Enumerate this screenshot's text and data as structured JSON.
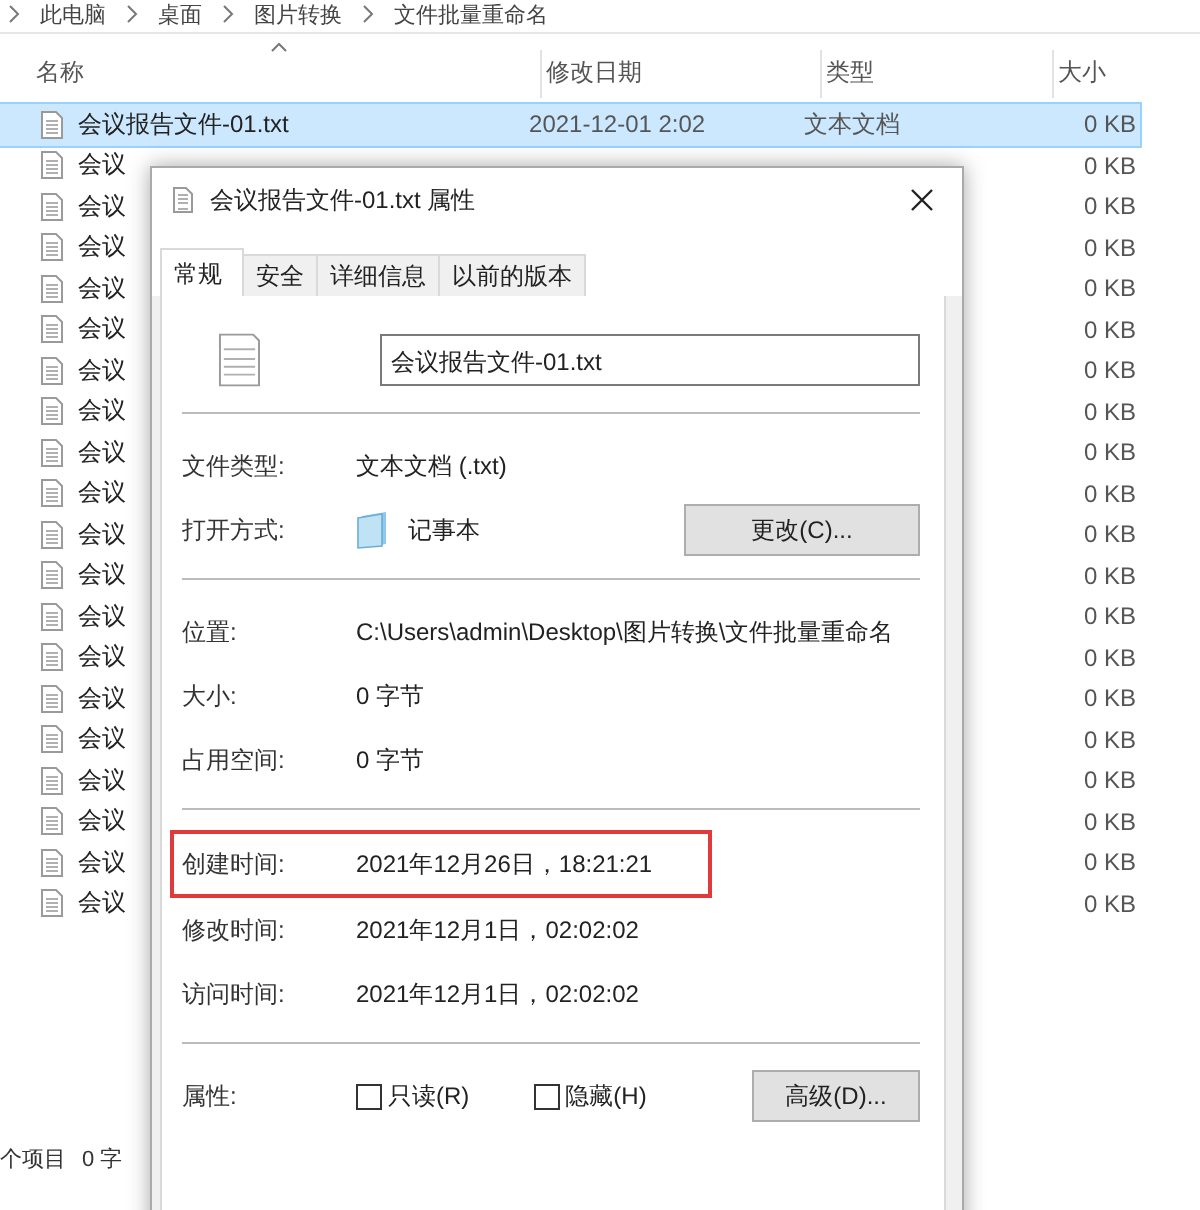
{
  "breadcrumb": [
    "此电脑",
    "桌面",
    "图片转换",
    "文件批量重命名"
  ],
  "file_list": {
    "columns": [
      "名称",
      "修改日期",
      "类型",
      "大小"
    ],
    "rows": [
      {
        "name": "会议报告文件-01.txt",
        "modified": "2021-12-01 2:02",
        "type": "文本文档",
        "size": "0 KB",
        "selected": true
      },
      {
        "name": "会议",
        "size": "0 KB",
        "selected": false
      },
      {
        "name": "会议",
        "size": "0 KB",
        "selected": false
      },
      {
        "name": "会议",
        "size": "0 KB",
        "selected": false
      },
      {
        "name": "会议",
        "size": "0 KB",
        "selected": false
      },
      {
        "name": "会议",
        "size": "0 KB",
        "selected": false
      },
      {
        "name": "会议",
        "size": "0 KB",
        "selected": false
      },
      {
        "name": "会议",
        "size": "0 KB",
        "selected": false
      },
      {
        "name": "会议",
        "size": "0 KB",
        "selected": false
      },
      {
        "name": "会议",
        "size": "0 KB",
        "selected": false
      },
      {
        "name": "会议",
        "size": "0 KB",
        "selected": false
      },
      {
        "name": "会议",
        "size": "0 KB",
        "selected": false
      },
      {
        "name": "会议",
        "size": "0 KB",
        "selected": false
      },
      {
        "name": "会议",
        "size": "0 KB",
        "selected": false
      },
      {
        "name": "会议",
        "size": "0 KB",
        "selected": false
      },
      {
        "name": "会议",
        "size": "0 KB",
        "selected": false
      },
      {
        "name": "会议",
        "size": "0 KB",
        "selected": false
      },
      {
        "name": "会议",
        "size": "0 KB",
        "selected": false
      },
      {
        "name": "会议",
        "size": "0 KB",
        "selected": false
      },
      {
        "name": "会议",
        "size": "0 KB",
        "selected": false
      }
    ]
  },
  "status_bar": [
    "个项目",
    "0 字"
  ],
  "dialog": {
    "title": "会议报告文件-01.txt 属性",
    "tabs": [
      {
        "label": "常规",
        "selected": true
      },
      {
        "label": "安全",
        "selected": false
      },
      {
        "label": "详细信息",
        "selected": false
      },
      {
        "label": "以前的版本",
        "selected": false
      }
    ],
    "file_name": "会议报告文件-01.txt",
    "sections": [
      [
        {
          "kind": "text",
          "label": "文件类型:",
          "value": "文本文档 (.txt)"
        },
        {
          "kind": "app",
          "label": "打开方式:",
          "value": "记事本",
          "button": "更改(C)..."
        }
      ],
      [
        {
          "kind": "text",
          "label": "位置:",
          "value": "C:\\Users\\admin\\Desktop\\图片转换\\文件批量重命名"
        },
        {
          "kind": "text",
          "label": "大小:",
          "value": "0 字节"
        },
        {
          "kind": "text",
          "label": "占用空间:",
          "value": "0 字节"
        }
      ],
      [
        {
          "kind": "text",
          "label": "创建时间:",
          "value": "2021年12月26日，18:21:21",
          "highlighted": true
        },
        {
          "kind": "text",
          "label": "修改时间:",
          "value": "2021年12月1日，02:02:02"
        },
        {
          "kind": "text",
          "label": "访问时间:",
          "value": "2021年12月1日，02:02:02"
        }
      ],
      [
        {
          "kind": "attributes",
          "label": "属性:",
          "options": [
            {
              "label": "只读(R)",
              "checked": false
            },
            {
              "label": "隐藏(H)",
              "checked": false
            }
          ],
          "button": "高级(D)..."
        }
      ]
    ]
  }
}
